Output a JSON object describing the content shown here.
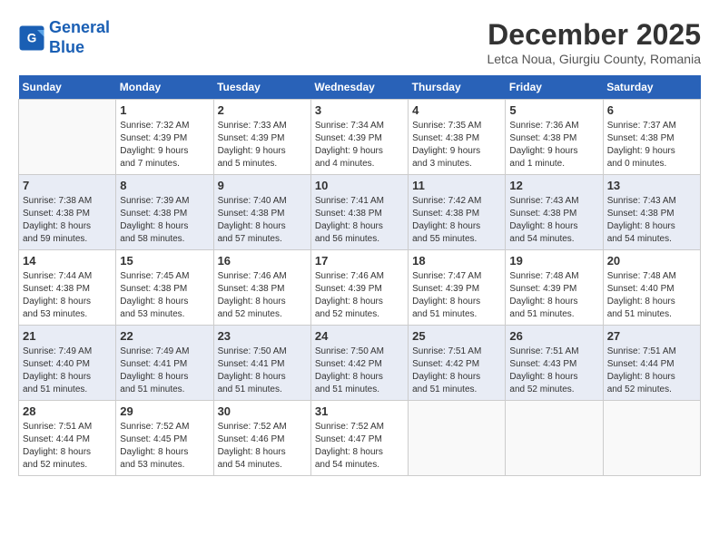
{
  "logo": {
    "line1": "General",
    "line2": "Blue"
  },
  "title": "December 2025",
  "subtitle": "Letca Noua, Giurgiu County, Romania",
  "weekdays": [
    "Sunday",
    "Monday",
    "Tuesday",
    "Wednesday",
    "Thursday",
    "Friday",
    "Saturday"
  ],
  "weeks": [
    [
      {
        "day": "",
        "info": ""
      },
      {
        "day": "1",
        "info": "Sunrise: 7:32 AM\nSunset: 4:39 PM\nDaylight: 9 hours\nand 7 minutes."
      },
      {
        "day": "2",
        "info": "Sunrise: 7:33 AM\nSunset: 4:39 PM\nDaylight: 9 hours\nand 5 minutes."
      },
      {
        "day": "3",
        "info": "Sunrise: 7:34 AM\nSunset: 4:39 PM\nDaylight: 9 hours\nand 4 minutes."
      },
      {
        "day": "4",
        "info": "Sunrise: 7:35 AM\nSunset: 4:38 PM\nDaylight: 9 hours\nand 3 minutes."
      },
      {
        "day": "5",
        "info": "Sunrise: 7:36 AM\nSunset: 4:38 PM\nDaylight: 9 hours\nand 1 minute."
      },
      {
        "day": "6",
        "info": "Sunrise: 7:37 AM\nSunset: 4:38 PM\nDaylight: 9 hours\nand 0 minutes."
      }
    ],
    [
      {
        "day": "7",
        "info": "Sunrise: 7:38 AM\nSunset: 4:38 PM\nDaylight: 8 hours\nand 59 minutes."
      },
      {
        "day": "8",
        "info": "Sunrise: 7:39 AM\nSunset: 4:38 PM\nDaylight: 8 hours\nand 58 minutes."
      },
      {
        "day": "9",
        "info": "Sunrise: 7:40 AM\nSunset: 4:38 PM\nDaylight: 8 hours\nand 57 minutes."
      },
      {
        "day": "10",
        "info": "Sunrise: 7:41 AM\nSunset: 4:38 PM\nDaylight: 8 hours\nand 56 minutes."
      },
      {
        "day": "11",
        "info": "Sunrise: 7:42 AM\nSunset: 4:38 PM\nDaylight: 8 hours\nand 55 minutes."
      },
      {
        "day": "12",
        "info": "Sunrise: 7:43 AM\nSunset: 4:38 PM\nDaylight: 8 hours\nand 54 minutes."
      },
      {
        "day": "13",
        "info": "Sunrise: 7:43 AM\nSunset: 4:38 PM\nDaylight: 8 hours\nand 54 minutes."
      }
    ],
    [
      {
        "day": "14",
        "info": "Sunrise: 7:44 AM\nSunset: 4:38 PM\nDaylight: 8 hours\nand 53 minutes."
      },
      {
        "day": "15",
        "info": "Sunrise: 7:45 AM\nSunset: 4:38 PM\nDaylight: 8 hours\nand 53 minutes."
      },
      {
        "day": "16",
        "info": "Sunrise: 7:46 AM\nSunset: 4:38 PM\nDaylight: 8 hours\nand 52 minutes."
      },
      {
        "day": "17",
        "info": "Sunrise: 7:46 AM\nSunset: 4:39 PM\nDaylight: 8 hours\nand 52 minutes."
      },
      {
        "day": "18",
        "info": "Sunrise: 7:47 AM\nSunset: 4:39 PM\nDaylight: 8 hours\nand 51 minutes."
      },
      {
        "day": "19",
        "info": "Sunrise: 7:48 AM\nSunset: 4:39 PM\nDaylight: 8 hours\nand 51 minutes."
      },
      {
        "day": "20",
        "info": "Sunrise: 7:48 AM\nSunset: 4:40 PM\nDaylight: 8 hours\nand 51 minutes."
      }
    ],
    [
      {
        "day": "21",
        "info": "Sunrise: 7:49 AM\nSunset: 4:40 PM\nDaylight: 8 hours\nand 51 minutes."
      },
      {
        "day": "22",
        "info": "Sunrise: 7:49 AM\nSunset: 4:41 PM\nDaylight: 8 hours\nand 51 minutes."
      },
      {
        "day": "23",
        "info": "Sunrise: 7:50 AM\nSunset: 4:41 PM\nDaylight: 8 hours\nand 51 minutes."
      },
      {
        "day": "24",
        "info": "Sunrise: 7:50 AM\nSunset: 4:42 PM\nDaylight: 8 hours\nand 51 minutes."
      },
      {
        "day": "25",
        "info": "Sunrise: 7:51 AM\nSunset: 4:42 PM\nDaylight: 8 hours\nand 51 minutes."
      },
      {
        "day": "26",
        "info": "Sunrise: 7:51 AM\nSunset: 4:43 PM\nDaylight: 8 hours\nand 52 minutes."
      },
      {
        "day": "27",
        "info": "Sunrise: 7:51 AM\nSunset: 4:44 PM\nDaylight: 8 hours\nand 52 minutes."
      }
    ],
    [
      {
        "day": "28",
        "info": "Sunrise: 7:51 AM\nSunset: 4:44 PM\nDaylight: 8 hours\nand 52 minutes."
      },
      {
        "day": "29",
        "info": "Sunrise: 7:52 AM\nSunset: 4:45 PM\nDaylight: 8 hours\nand 53 minutes."
      },
      {
        "day": "30",
        "info": "Sunrise: 7:52 AM\nSunset: 4:46 PM\nDaylight: 8 hours\nand 54 minutes."
      },
      {
        "day": "31",
        "info": "Sunrise: 7:52 AM\nSunset: 4:47 PM\nDaylight: 8 hours\nand 54 minutes."
      },
      {
        "day": "",
        "info": ""
      },
      {
        "day": "",
        "info": ""
      },
      {
        "day": "",
        "info": ""
      }
    ]
  ]
}
